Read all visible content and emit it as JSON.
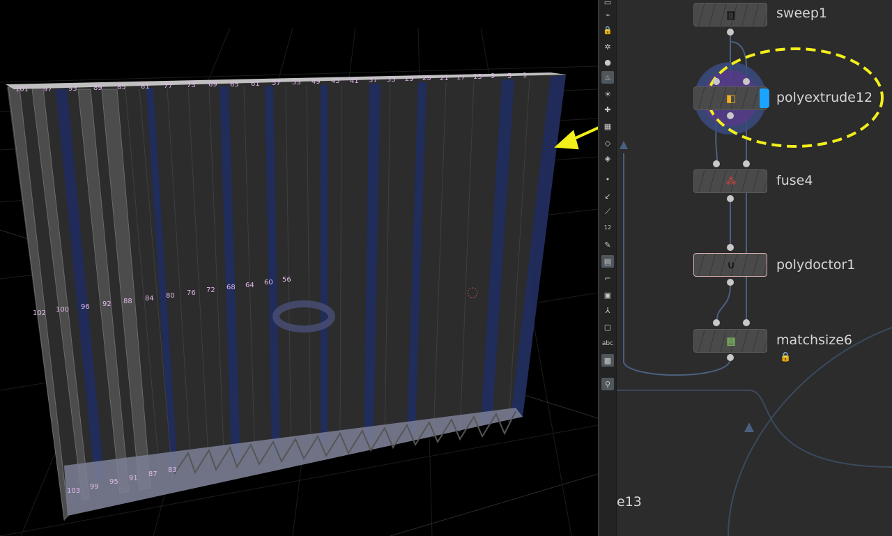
{
  "viewport": {
    "top_point_labels": [
      "101",
      "97",
      "93",
      "89",
      "85",
      "81",
      "77",
      "73",
      "69",
      "65",
      "61",
      "57",
      "53",
      "49",
      "45",
      "41",
      "37",
      "33",
      "29",
      "25",
      "21",
      "17",
      "13",
      "9",
      "5",
      "1"
    ],
    "mid_point_labels": [
      "102",
      "100",
      "96",
      "92",
      "88",
      "84",
      "80",
      "76",
      "72",
      "68",
      "64",
      "60",
      "56"
    ],
    "bottom_point_labels": [
      "103",
      "99",
      "95",
      "91",
      "87",
      "83"
    ]
  },
  "toolbar": {
    "text_tool_label": "abc",
    "point_numbers_label": "12"
  },
  "network": {
    "nodes": [
      {
        "name": "sweep1",
        "icon": "sweep-icon"
      },
      {
        "name": "polyextrude12",
        "icon": "polyextrude-icon"
      },
      {
        "name": "fuse4",
        "icon": "fuse-icon"
      },
      {
        "name": "polydoctor1",
        "icon": "stethoscope-icon"
      },
      {
        "name": "matchsize6",
        "icon": "matchsize-icon"
      }
    ],
    "partial_node_label": "e13",
    "lock_icon": "lock-icon"
  },
  "colors": {
    "highlight": "#f2ef1a",
    "selected_flag": "#1aa3ff",
    "wall_blue": "#1c2a5e",
    "point_label": "#e0b8e8"
  }
}
